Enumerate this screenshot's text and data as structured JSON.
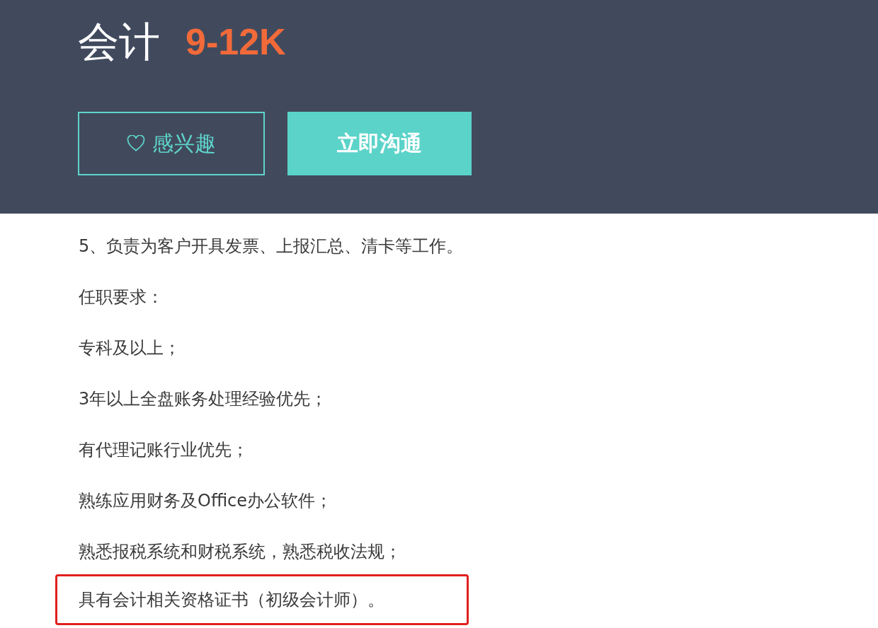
{
  "job": {
    "title": "会计",
    "salary": "9-12K"
  },
  "buttons": [
    {
      "kind": "outline",
      "label": "感兴趣"
    },
    {
      "kind": "primary",
      "label": "立即沟通"
    }
  ],
  "description": [
    {
      "text": "5、负责为客户开具发票、上报汇总、清卡等工作。",
      "highlighted": false
    },
    {
      "text": "任职要求：",
      "highlighted": false
    },
    {
      "text": "专科及以上；",
      "highlighted": false
    },
    {
      "text": "3年以上全盘账务处理经验优先；",
      "highlighted": false
    },
    {
      "text": "有代理记账行业优先；",
      "highlighted": false
    },
    {
      "text": "熟练应用财务及Office办公软件；",
      "highlighted": false
    },
    {
      "text": "熟悉报税系统和财税系统，熟悉税收法规；",
      "highlighted": false
    },
    {
      "text": "具有会计相关资格证书（初级会计师）。",
      "highlighted": true
    }
  ]
}
